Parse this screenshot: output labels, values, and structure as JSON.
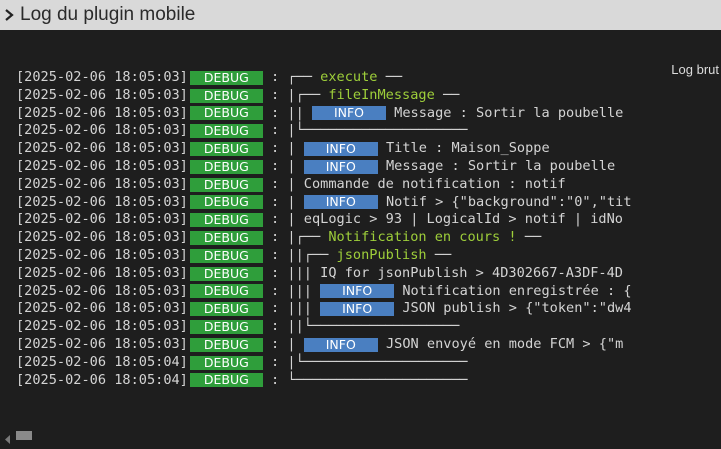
{
  "header": {
    "title": "Log du plugin mobile",
    "collapse_icon": "chevron-right-icon"
  },
  "toolbar": {
    "raw_log_label": "Log brut"
  },
  "log_lines": [
    {
      "ts": "[2025-02-06 18:05:03]",
      "level": "DEBUG",
      "prefix": " : ┌── ",
      "badge": "",
      "text": "execute",
      "text_class": "green",
      "suffix": " ──"
    },
    {
      "ts": "[2025-02-06 18:05:03]",
      "level": "DEBUG",
      "prefix": " : |┌── ",
      "badge": "",
      "text": "fileInMessage",
      "text_class": "green",
      "suffix": " ──"
    },
    {
      "ts": "[2025-02-06 18:05:03]",
      "level": "DEBUG",
      "prefix": " : || ",
      "badge": "INFO",
      "text": " Message : Sortir la poubelle",
      "text_class": "msg",
      "suffix": ""
    },
    {
      "ts": "[2025-02-06 18:05:03]",
      "level": "DEBUG",
      "prefix": " : |└────────────────────",
      "badge": "",
      "text": "",
      "text_class": "msg",
      "suffix": ""
    },
    {
      "ts": "[2025-02-06 18:05:03]",
      "level": "DEBUG",
      "prefix": " : | ",
      "badge": "INFO",
      "text": " Title : Maison_Soppe",
      "text_class": "msg",
      "suffix": ""
    },
    {
      "ts": "[2025-02-06 18:05:03]",
      "level": "DEBUG",
      "prefix": " : | ",
      "badge": "INFO",
      "text": " Message : Sortir la poubelle",
      "text_class": "msg",
      "suffix": ""
    },
    {
      "ts": "[2025-02-06 18:05:03]",
      "level": "DEBUG",
      "prefix": " : | ",
      "badge": "",
      "text": "Commande de notification : notif",
      "text_class": "msg",
      "suffix": ""
    },
    {
      "ts": "[2025-02-06 18:05:03]",
      "level": "DEBUG",
      "prefix": " : | ",
      "badge": "INFO",
      "text": " Notif > {\"background\":\"0\",\"tit",
      "text_class": "msg",
      "suffix": ""
    },
    {
      "ts": "[2025-02-06 18:05:03]",
      "level": "DEBUG",
      "prefix": " : | ",
      "badge": "",
      "text": "eqLogic > 93 | LogicalId > notif | idNo",
      "text_class": "msg",
      "suffix": ""
    },
    {
      "ts": "[2025-02-06 18:05:03]",
      "level": "DEBUG",
      "prefix": " : |┌── ",
      "badge": "",
      "text": "Notification en cours !",
      "text_class": "green",
      "suffix": " ──"
    },
    {
      "ts": "[2025-02-06 18:05:03]",
      "level": "DEBUG",
      "prefix": " : ||┌── ",
      "badge": "",
      "text": "jsonPublish",
      "text_class": "green",
      "suffix": " ──"
    },
    {
      "ts": "[2025-02-06 18:05:03]",
      "level": "DEBUG",
      "prefix": " : ||| ",
      "badge": "",
      "text": "IQ for jsonPublish > 4D302667-A3DF-4D",
      "text_class": "msg",
      "suffix": ""
    },
    {
      "ts": "[2025-02-06 18:05:03]",
      "level": "DEBUG",
      "prefix": " : ||| ",
      "badge": "INFO",
      "text": " Notification enregistrée : {",
      "text_class": "msg",
      "suffix": ""
    },
    {
      "ts": "[2025-02-06 18:05:03]",
      "level": "DEBUG",
      "prefix": " : ||| ",
      "badge": "INFO",
      "text": " JSON publish > {\"token\":\"dw4",
      "text_class": "msg",
      "suffix": ""
    },
    {
      "ts": "[2025-02-06 18:05:03]",
      "level": "DEBUG",
      "prefix": " : ||└──────────────────",
      "badge": "",
      "text": "",
      "text_class": "msg",
      "suffix": ""
    },
    {
      "ts": "[2025-02-06 18:05:03]",
      "level": "DEBUG",
      "prefix": " : | ",
      "badge": "INFO",
      "text": " JSON envoyé en mode FCM > {\"m",
      "text_class": "msg",
      "suffix": ""
    },
    {
      "ts": "[2025-02-06 18:05:04]",
      "level": "DEBUG",
      "prefix": " : |└────────────────────",
      "badge": "",
      "text": "",
      "text_class": "msg",
      "suffix": ""
    },
    {
      "ts": "[2025-02-06 18:05:04]",
      "level": "DEBUG",
      "prefix": " : └─────────────────────",
      "badge": "",
      "text": "",
      "text_class": "msg",
      "suffix": ""
    }
  ],
  "colors": {
    "debug_badge": "#2f9e3b",
    "info_badge": "#4a7fc1",
    "highlight_text": "#9ecf3a",
    "background": "#1e1e1e"
  }
}
